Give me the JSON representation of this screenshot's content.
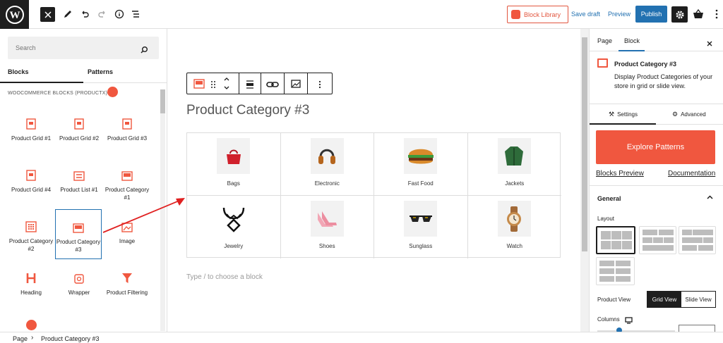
{
  "topbar": {
    "block_library": "Block Library",
    "save_draft": "Save draft",
    "preview": "Preview",
    "publish": "Publish"
  },
  "inserter": {
    "search_placeholder": "Search",
    "tabs": [
      "Blocks",
      "Patterns"
    ],
    "category": "WOOCOMMERCE BLOCKS (PRODUCTX)",
    "blocks": [
      {
        "label": "Product Grid #1",
        "icon": "grid-icon"
      },
      {
        "label": "Product Grid #2",
        "icon": "grid-icon"
      },
      {
        "label": "Product Grid #3",
        "icon": "grid-icon"
      },
      {
        "label": "Product Grid #4",
        "icon": "grid-icon"
      },
      {
        "label": "Product List #1",
        "icon": "list-icon"
      },
      {
        "label": "Product Category #1",
        "icon": "category-icon"
      },
      {
        "label": "Product Category #2",
        "icon": "category-icon"
      },
      {
        "label": "Product Category #3",
        "icon": "category-icon"
      },
      {
        "label": "Image",
        "icon": "image-icon"
      },
      {
        "label": "Heading",
        "icon": "heading-icon"
      },
      {
        "label": "Wrapper",
        "icon": "wrapper-icon"
      },
      {
        "label": "Product Filtering",
        "icon": "filter-icon"
      }
    ]
  },
  "canvas": {
    "title": "Product Category #3",
    "categories": [
      "Bags",
      "Electronic",
      "Fast Food",
      "Jackets",
      "Jewelry",
      "Shoes",
      "Sunglass",
      "Watch"
    ],
    "hint": "Type / to choose a block"
  },
  "sidebar": {
    "tabs": [
      "Page",
      "Block"
    ],
    "block_title": "Product Category #3",
    "block_desc": "Display Product Categories of your store in grid or slide view.",
    "settings_tabs": [
      "Settings",
      "Advanced"
    ],
    "explore": "Explore Patterns",
    "blocks_preview": "Blocks Preview",
    "documentation": "Documentation",
    "general": "General",
    "layout_label": "Layout",
    "product_view_label": "Product View",
    "grid_view": "Grid View",
    "slide_view": "Slide View",
    "columns_label": "Columns"
  },
  "breadcrumb": {
    "root": "Page",
    "current": "Product Category #3"
  },
  "colors": {
    "accent": "#f0573f",
    "primary": "#2271b1",
    "dark": "#1e1e1e"
  }
}
